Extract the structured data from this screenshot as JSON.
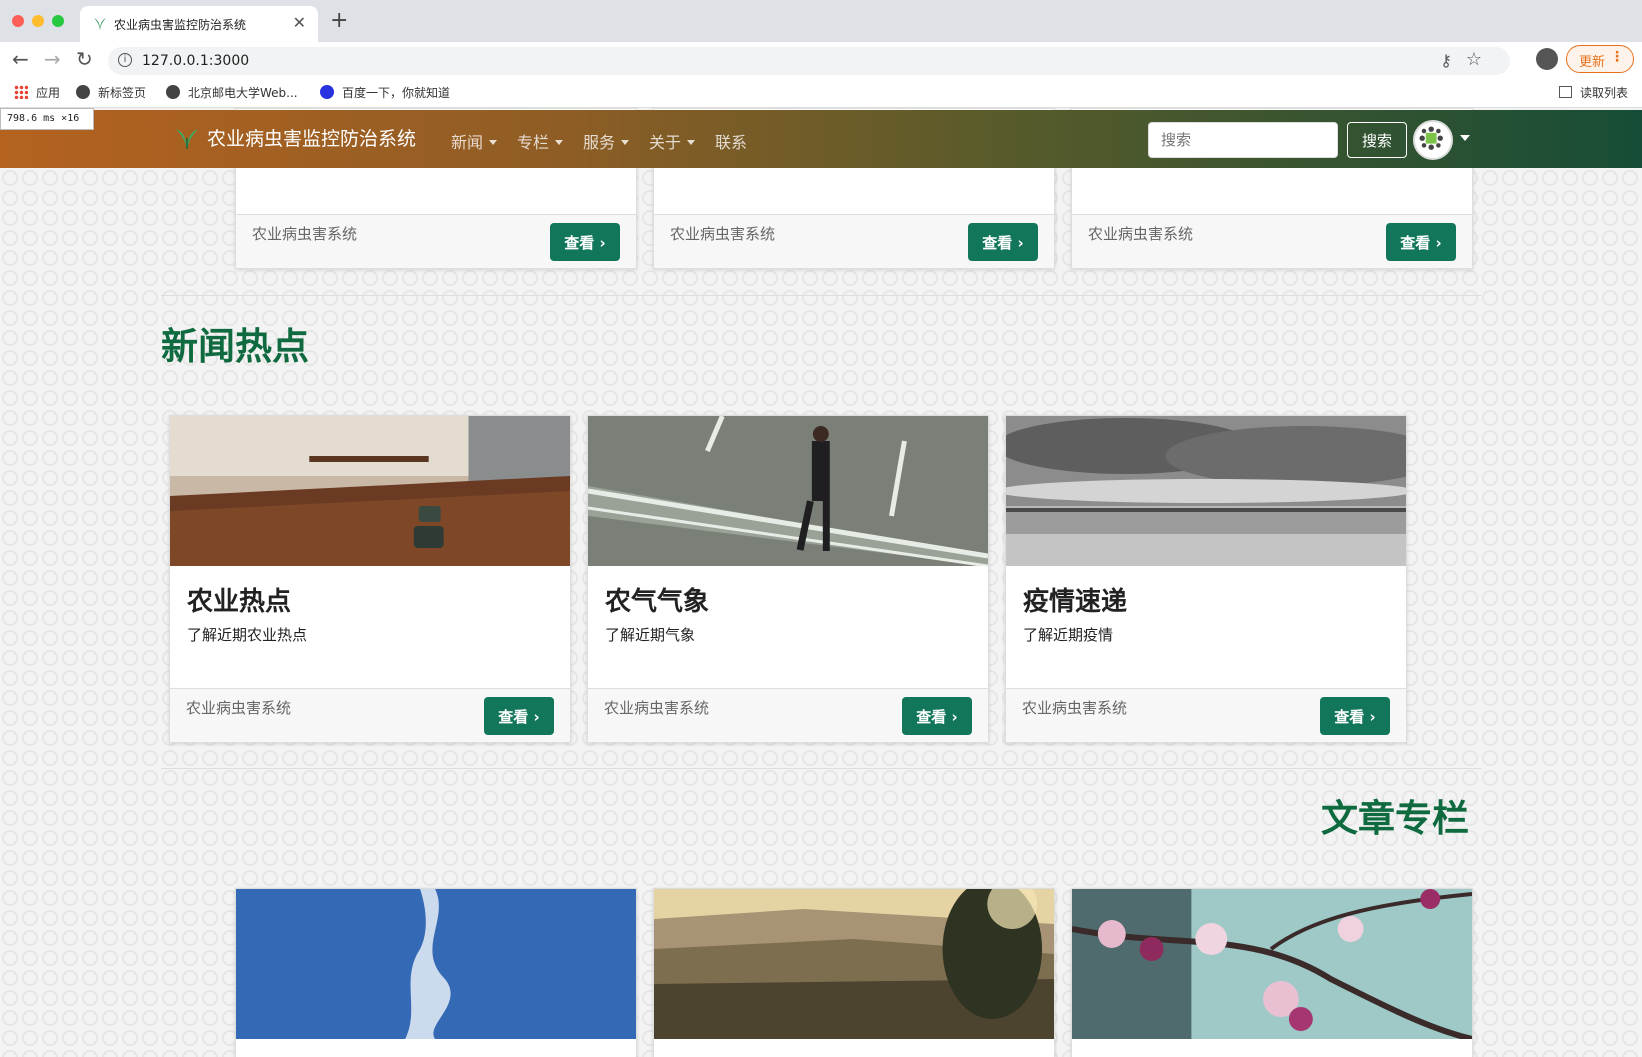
{
  "browser": {
    "tab_title": "农业病虫害监控防治系统",
    "url": "127.0.0.1:3000",
    "update_label": "更新",
    "bookmarks": [
      {
        "label": "应用"
      },
      {
        "label": "新标签页"
      },
      {
        "label": "北京邮电大学Web..."
      },
      {
        "label": "百度一下，你就知道"
      }
    ],
    "reading_list": "读取列表",
    "perf_overlay": "798.6 ms ×16"
  },
  "navbar": {
    "brand": "农业病虫害监控防治系统",
    "menu": [
      {
        "label": "新闻"
      },
      {
        "label": "专栏"
      },
      {
        "label": "服务"
      },
      {
        "label": "关于"
      },
      {
        "label": "联系"
      }
    ],
    "search_placeholder": "搜索",
    "search_button": "搜索"
  },
  "top_cards": [
    {
      "footer": "农业病虫害系统",
      "button": "查看 ›"
    },
    {
      "footer": "农业病虫害系统",
      "button": "查看 ›"
    },
    {
      "footer": "农业病虫害系统",
      "button": "查看 ›"
    }
  ],
  "news_section": {
    "title": "新闻热点",
    "cards": [
      {
        "title": "农业热点",
        "desc": "了解近期农业热点",
        "footer": "农业病虫害系统",
        "button": "查看 ›"
      },
      {
        "title": "农气气象",
        "desc": "了解近期气象",
        "footer": "农业病虫害系统",
        "button": "查看 ›"
      },
      {
        "title": "疫情速递",
        "desc": "了解近期疫情",
        "footer": "农业病虫害系统",
        "button": "查看 ›"
      }
    ]
  },
  "articles_section": {
    "title": "文章专栏"
  },
  "colors": {
    "brand_green": "#0f6b3f",
    "button_green": "#12775a",
    "update_orange": "#e8711d"
  }
}
